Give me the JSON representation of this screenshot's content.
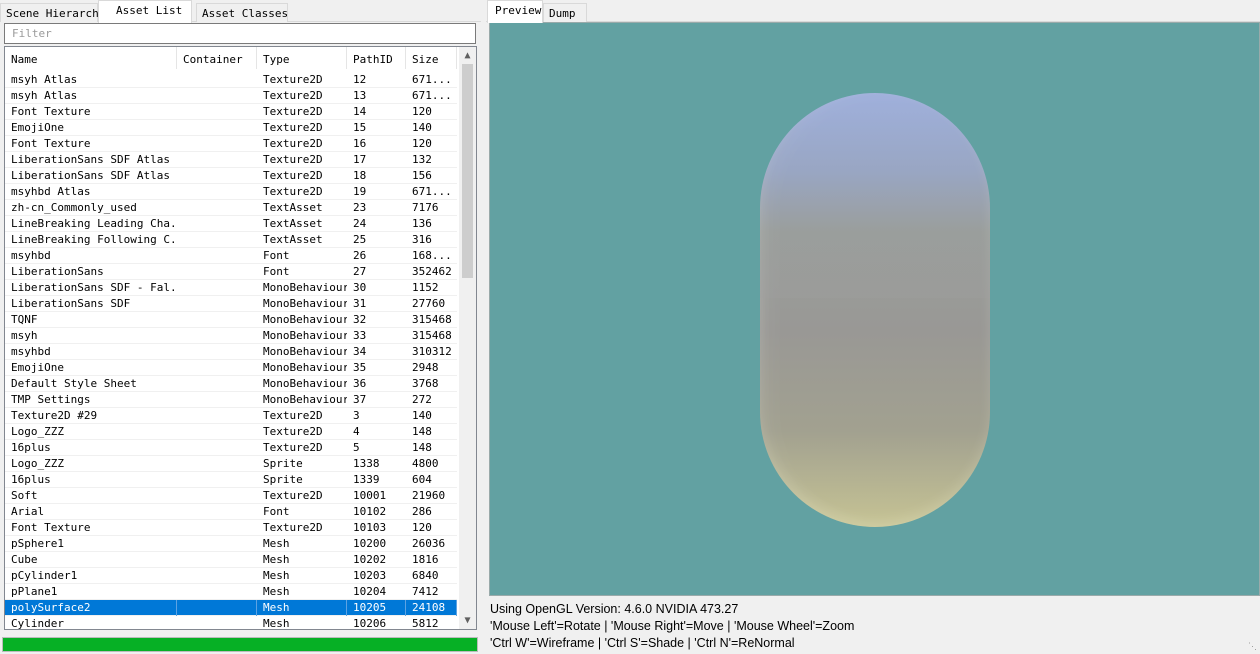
{
  "left_tabs": [
    "Scene Hierarchy",
    "Asset List",
    "Asset Classes"
  ],
  "active_left_tab": "Asset List",
  "filter": {
    "placeholder": "Filter",
    "value": ""
  },
  "columns": [
    "Name",
    "Container",
    "Type",
    "PathID",
    "Size"
  ],
  "assets": [
    {
      "name": "msyh Atlas",
      "container": "",
      "type": "Texture2D",
      "path_id": "12",
      "size": "671..."
    },
    {
      "name": "msyh Atlas",
      "container": "",
      "type": "Texture2D",
      "path_id": "13",
      "size": "671..."
    },
    {
      "name": "Font Texture",
      "container": "",
      "type": "Texture2D",
      "path_id": "14",
      "size": "120"
    },
    {
      "name": "EmojiOne",
      "container": "",
      "type": "Texture2D",
      "path_id": "15",
      "size": "140"
    },
    {
      "name": "Font Texture",
      "container": "",
      "type": "Texture2D",
      "path_id": "16",
      "size": "120"
    },
    {
      "name": "LiberationSans SDF Atlas",
      "container": "",
      "type": "Texture2D",
      "path_id": "17",
      "size": "132"
    },
    {
      "name": "LiberationSans SDF Atlas",
      "container": "",
      "type": "Texture2D",
      "path_id": "18",
      "size": "156"
    },
    {
      "name": "msyhbd Atlas",
      "container": "",
      "type": "Texture2D",
      "path_id": "19",
      "size": "671..."
    },
    {
      "name": "zh-cn_Commonly_used",
      "container": "",
      "type": "TextAsset",
      "path_id": "23",
      "size": "7176"
    },
    {
      "name": "LineBreaking Leading Cha...",
      "container": "",
      "type": "TextAsset",
      "path_id": "24",
      "size": "136"
    },
    {
      "name": "LineBreaking Following C...",
      "container": "",
      "type": "TextAsset",
      "path_id": "25",
      "size": "316"
    },
    {
      "name": "msyhbd",
      "container": "",
      "type": "Font",
      "path_id": "26",
      "size": "168..."
    },
    {
      "name": "LiberationSans",
      "container": "",
      "type": "Font",
      "path_id": "27",
      "size": "352462"
    },
    {
      "name": "LiberationSans SDF - Fal...",
      "container": "",
      "type": "MonoBehaviour",
      "path_id": "30",
      "size": "1152"
    },
    {
      "name": "LiberationSans SDF",
      "container": "",
      "type": "MonoBehaviour",
      "path_id": "31",
      "size": "27760"
    },
    {
      "name": "TQNF",
      "container": "",
      "type": "MonoBehaviour",
      "path_id": "32",
      "size": "315468"
    },
    {
      "name": "msyh",
      "container": "",
      "type": "MonoBehaviour",
      "path_id": "33",
      "size": "315468"
    },
    {
      "name": "msyhbd",
      "container": "",
      "type": "MonoBehaviour",
      "path_id": "34",
      "size": "310312"
    },
    {
      "name": "EmojiOne",
      "container": "",
      "type": "MonoBehaviour",
      "path_id": "35",
      "size": "2948"
    },
    {
      "name": "Default Style Sheet",
      "container": "",
      "type": "MonoBehaviour",
      "path_id": "36",
      "size": "3768"
    },
    {
      "name": "TMP Settings",
      "container": "",
      "type": "MonoBehaviour",
      "path_id": "37",
      "size": "272"
    },
    {
      "name": "Texture2D #29",
      "container": "",
      "type": "Texture2D",
      "path_id": "3",
      "size": "140"
    },
    {
      "name": "Logo_ZZZ",
      "container": "",
      "type": "Texture2D",
      "path_id": "4",
      "size": "148"
    },
    {
      "name": "16plus",
      "container": "",
      "type": "Texture2D",
      "path_id": "5",
      "size": "148"
    },
    {
      "name": "Logo_ZZZ",
      "container": "",
      "type": "Sprite",
      "path_id": "1338",
      "size": "4800"
    },
    {
      "name": "16plus",
      "container": "",
      "type": "Sprite",
      "path_id": "1339",
      "size": "604"
    },
    {
      "name": "Soft",
      "container": "",
      "type": "Texture2D",
      "path_id": "10001",
      "size": "21960"
    },
    {
      "name": "Arial",
      "container": "",
      "type": "Font",
      "path_id": "10102",
      "size": "286"
    },
    {
      "name": "Font Texture",
      "container": "",
      "type": "Texture2D",
      "path_id": "10103",
      "size": "120"
    },
    {
      "name": "pSphere1",
      "container": "",
      "type": "Mesh",
      "path_id": "10200",
      "size": "26036"
    },
    {
      "name": "Cube",
      "container": "",
      "type": "Mesh",
      "path_id": "10202",
      "size": "1816"
    },
    {
      "name": "pCylinder1",
      "container": "",
      "type": "Mesh",
      "path_id": "10203",
      "size": "6840"
    },
    {
      "name": "pPlane1",
      "container": "",
      "type": "Mesh",
      "path_id": "10204",
      "size": "7412"
    },
    {
      "name": "polySurface2",
      "container": "",
      "type": "Mesh",
      "path_id": "10205",
      "size": "24108"
    },
    {
      "name": "Cylinder",
      "container": "",
      "type": "Mesh",
      "path_id": "10206",
      "size": "5812"
    }
  ],
  "selected_index": 33,
  "progress": 1.0,
  "right_tabs": [
    "Preview",
    "Dump"
  ],
  "active_right_tab": "Preview",
  "info_lines": [
    "Using OpenGL Version: 4.6.0 NVIDIA 473.27",
    "'Mouse Left'=Rotate | 'Mouse Right'=Move | 'Mouse Wheel'=Zoom",
    "'Ctrl W'=Wireframe | 'Ctrl S'=Shade | 'Ctrl N'=ReNormal"
  ],
  "colors": {
    "viewport_bg": "#62a1a2",
    "selection": "#0078d7",
    "progress": "#06b025"
  }
}
